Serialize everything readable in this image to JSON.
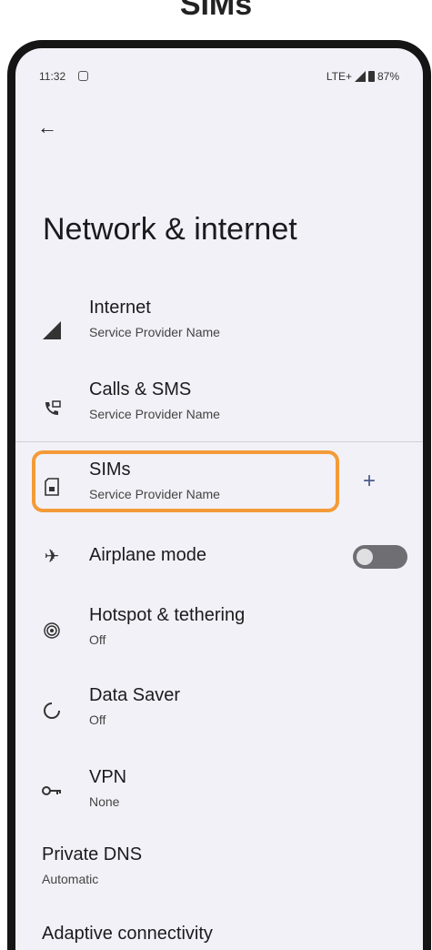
{
  "heading": "SIMs",
  "status_bar": {
    "time": "11:32",
    "network": "LTE+",
    "battery": "87%"
  },
  "page_title": "Network & internet",
  "items": {
    "internet": {
      "title": "Internet",
      "subtitle": "Service Provider Name"
    },
    "calls": {
      "title": "Calls & SMS",
      "subtitle": "Service Provider Name"
    },
    "sims": {
      "title": "SIMs",
      "subtitle": "Service Provider Name"
    },
    "airplane": {
      "title": "Airplane mode",
      "enabled": false
    },
    "hotspot": {
      "title": "Hotspot & tethering",
      "subtitle": "Off"
    },
    "datasaver": {
      "title": "Data Saver",
      "subtitle": "Off"
    },
    "vpn": {
      "title": "VPN",
      "subtitle": "None"
    },
    "privatedns": {
      "title": "Private DNS",
      "subtitle": "Automatic"
    },
    "adaptive": {
      "title": "Adaptive connectivity"
    }
  },
  "colors": {
    "highlight": "#f39b38",
    "background": "#f2f1f7"
  }
}
